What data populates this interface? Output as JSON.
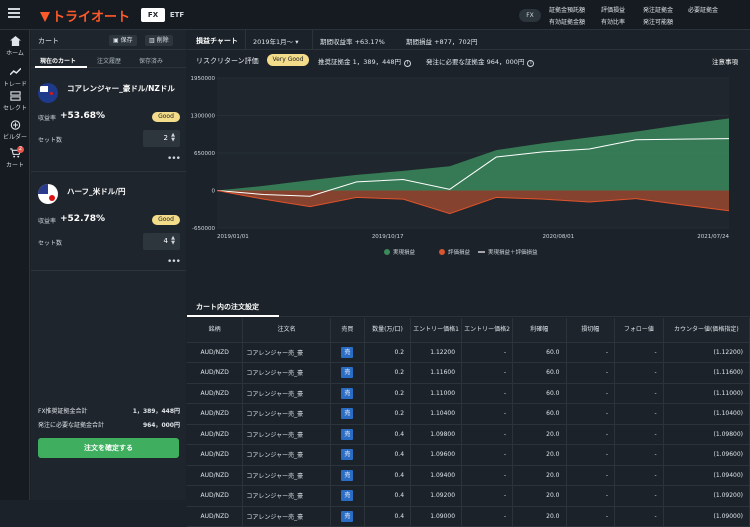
{
  "topbar": {
    "logo": "トライオート",
    "seg_fx": "FX",
    "seg_etf": "ETF",
    "account_badge": "FX",
    "links": [
      "証拠金預託額",
      "評価損益",
      "発注証拠金",
      "必要証拠金",
      "有効証拠金額",
      "有効比率",
      "発注可能額"
    ]
  },
  "nav": [
    {
      "label": "ホーム",
      "icon": "home-icon"
    },
    {
      "label": "トレード",
      "icon": "trend-icon"
    },
    {
      "label": "セレクト",
      "icon": "select-icon"
    },
    {
      "label": "ビルダー",
      "icon": "plus-circle-icon"
    },
    {
      "label": "カート",
      "icon": "cart-icon",
      "badge": "2"
    }
  ],
  "cart": {
    "title": "カート",
    "save": "保存",
    "delete": "削除",
    "tabs": [
      "現在のカート",
      "注文履歴",
      "保存済み"
    ],
    "items": [
      {
        "name": "コアレンジャー_豪ドル/NZドル",
        "rate_label": "収益率",
        "rate": "+53.68%",
        "badge": "Good",
        "set_label": "セット数",
        "sets": "2"
      },
      {
        "name": "ハーフ_米ドル/円",
        "rate_label": "収益率",
        "rate": "+52.78%",
        "badge": "Good",
        "set_label": "セット数",
        "sets": "4"
      }
    ],
    "summary": [
      {
        "label": "FX推奨証拠金合計",
        "value": "1，389，448円"
      },
      {
        "label": "発注に必要な証拠金合計",
        "value": "964，000円"
      }
    ],
    "confirm": "注文を確定する"
  },
  "main": {
    "chart_tab": "損益チャート",
    "period": "2019年1月～",
    "period_rate": "期間収益率 +63.17%",
    "period_pl": "期間損益 +877，702円",
    "risk_label": "リスクリターン評価",
    "risk_badge": "Very Good",
    "recommended": "推奨証拠金 1，389，448円",
    "required": "発注に必要な証拠金 964，000円",
    "notes": "注意事項"
  },
  "chart_data": {
    "type": "area",
    "y_ticks": [
      "1950000",
      "1300000",
      "650000",
      "0",
      "-650000"
    ],
    "x_ticks": [
      "2019/01/01",
      "2019/10/17",
      "2020/08/01",
      "2021/07/24"
    ],
    "ylim": [
      -650000,
      1950000
    ],
    "legend": [
      "実現損益",
      "評価損益",
      "実現損益＋評価損益"
    ],
    "colors": {
      "realized": "#3a8a5c",
      "unrealized": "#c9552f",
      "total": "#ffffff"
    },
    "x": [
      "2019/01",
      "2019/04",
      "2019/07",
      "2019/10",
      "2020/01",
      "2020/03",
      "2020/04",
      "2020/07",
      "2020/10",
      "2021/01",
      "2021/04",
      "2021/07"
    ],
    "series": [
      {
        "name": "実現損益",
        "values": [
          0,
          80000,
          180000,
          270000,
          340000,
          420000,
          700000,
          820000,
          920000,
          1020000,
          1140000,
          1250000
        ]
      },
      {
        "name": "評価損益",
        "values": [
          0,
          -150000,
          -280000,
          -120000,
          -150000,
          -400000,
          -120000,
          -150000,
          -200000,
          -140000,
          -250000,
          -350000
        ]
      },
      {
        "name": "実現損益＋評価損益",
        "values": [
          0,
          -70000,
          -100000,
          150000,
          190000,
          20000,
          580000,
          670000,
          720000,
          880000,
          890000,
          900000
        ]
      }
    ]
  },
  "orders": {
    "title": "カート内の注文設定",
    "columns": [
      "銘柄",
      "注文名",
      "売買",
      "数量(万/口)",
      "エントリー価格1",
      "エントリー価格2",
      "利確幅",
      "損切幅",
      "フォロー値",
      "カウンター値(価格指定)"
    ],
    "rows": [
      [
        "AUD/NZD",
        "コアレンジャー売_豪",
        "売",
        "0.2",
        "1.12200",
        "-",
        "60.0",
        "-",
        "-",
        "(1.12200)"
      ],
      [
        "AUD/NZD",
        "コアレンジャー売_豪",
        "売",
        "0.2",
        "1.11600",
        "-",
        "60.0",
        "-",
        "-",
        "(1.11600)"
      ],
      [
        "AUD/NZD",
        "コアレンジャー売_豪",
        "売",
        "0.2",
        "1.11000",
        "-",
        "60.0",
        "-",
        "-",
        "(1.11000)"
      ],
      [
        "AUD/NZD",
        "コアレンジャー売_豪",
        "売",
        "0.2",
        "1.10400",
        "-",
        "60.0",
        "-",
        "-",
        "(1.10400)"
      ],
      [
        "AUD/NZD",
        "コアレンジャー売_豪",
        "売",
        "0.4",
        "1.09800",
        "-",
        "20.0",
        "-",
        "-",
        "(1.09800)"
      ],
      [
        "AUD/NZD",
        "コアレンジャー売_豪",
        "売",
        "0.4",
        "1.09600",
        "-",
        "20.0",
        "-",
        "-",
        "(1.09600)"
      ],
      [
        "AUD/NZD",
        "コアレンジャー売_豪",
        "売",
        "0.4",
        "1.09400",
        "-",
        "20.0",
        "-",
        "-",
        "(1.09400)"
      ],
      [
        "AUD/NZD",
        "コアレンジャー売_豪",
        "売",
        "0.4",
        "1.09200",
        "-",
        "20.0",
        "-",
        "-",
        "(1.09200)"
      ],
      [
        "AUD/NZD",
        "コアレンジャー売_豪",
        "売",
        "0.4",
        "1.09000",
        "-",
        "20.0",
        "-",
        "-",
        "(1.09000)"
      ]
    ]
  }
}
